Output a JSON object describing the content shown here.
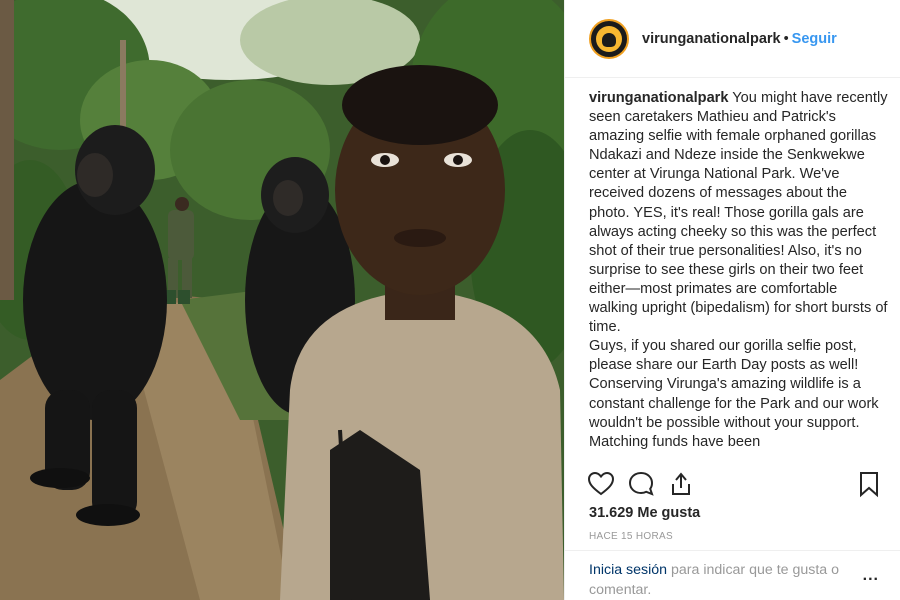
{
  "header": {
    "username": "virunganationalpark",
    "separator": "•",
    "follow_label": "Seguir"
  },
  "caption": {
    "username": "virunganationalpark",
    "paragraph1": "You might have recently seen caretakers Mathieu and Patrick's amazing selfie with female orphaned gorillas Ndakazi and Ndeze inside the Senkwekwe center at Virunga National Park. We've received dozens of messages about the photo. YES, it's real! Those gorilla gals are always acting cheeky so this was the perfect shot of their true personalities! Also, it's no surprise to see these girls on their two feet either—most primates are comfortable walking upright (bipedalism) for short bursts of time.",
    "paragraph2": "Guys, if you shared our gorilla selfie post, please share our Earth Day posts as well! Conserving Virunga's amazing wildlife is a constant challenge for the Park and our work wouldn't be possible without your support. Matching funds have been"
  },
  "actions": {
    "like_icon": "heart-icon",
    "comment_icon": "comment-icon",
    "share_icon": "share-icon",
    "save_icon": "bookmark-icon"
  },
  "likes_text": "31.629 Me gusta",
  "timestamp": "HACE 15 HORAS",
  "comment": {
    "login_label": "Inicia sesión",
    "rest_text": " para indicar que te gusta o comentar.",
    "more_label": "..."
  },
  "colors": {
    "accent": "#3897f0",
    "muted": "#999999",
    "login": "#003569",
    "text": "#262626"
  }
}
